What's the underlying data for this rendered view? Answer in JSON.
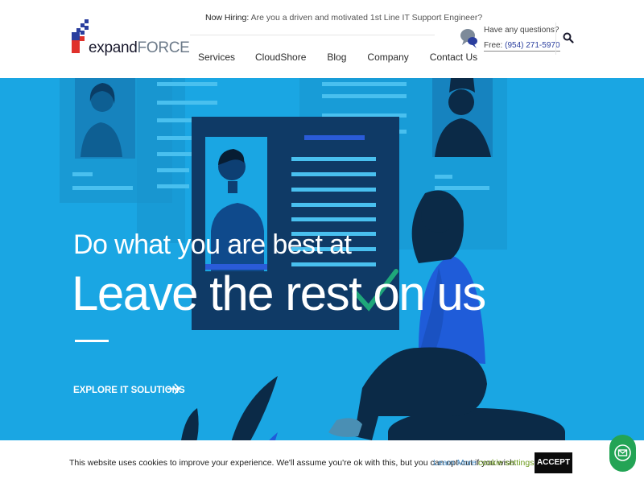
{
  "brand": {
    "name_part1": "expand",
    "name_part2": "FORCE",
    "colors": {
      "red": "#e0312b",
      "blue": "#2a3e9e",
      "dark": "#1a1a2e"
    }
  },
  "header": {
    "hiring_label": "Now Hiring:",
    "hiring_text": "Are you a driven and motivated 1st Line IT Support Engineer?",
    "nav": [
      "Services",
      "CloudShore",
      "Blog",
      "Company",
      "Contact Us"
    ],
    "contact_question": "Have any questions?",
    "contact_phone_label": "Free:",
    "contact_phone": "(954) 271-5970",
    "search_icon": "search-icon"
  },
  "hero": {
    "subtitle": "Do what you are best at",
    "title": "Leave the rest on us",
    "cta": "EXPLORE IT SOLUTIONS",
    "background": "#1aa6e3"
  },
  "cookie": {
    "text": "This website uses cookies to improve your experience. We'll assume you're ok with this, but you can opt-out if you wish.",
    "learn_more": "Learn More",
    "settings": "cookie settings",
    "accept": "ACCEPT"
  },
  "fab": {
    "icon": "mail-icon",
    "color": "#23a455"
  }
}
